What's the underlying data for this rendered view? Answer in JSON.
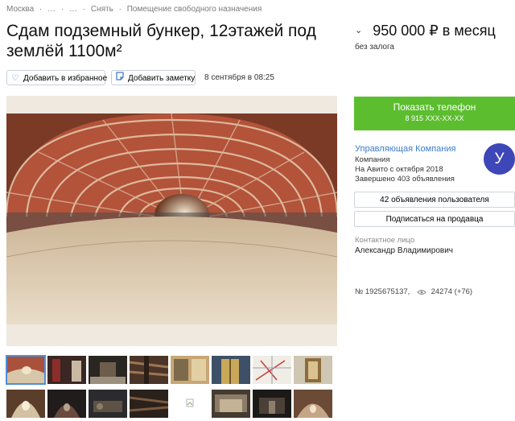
{
  "breadcrumb": {
    "items": [
      "Москва",
      "·",
      "…",
      "·",
      "…",
      "·",
      "Снять",
      "·",
      "Помещение свободного назначения"
    ]
  },
  "listing": {
    "title": "Сдам подземный бункер, 12этажей под землёй 1100м²",
    "price": "950 000 ₽ в месяц",
    "deposit": "без залога",
    "date": "8 сентября в 08:25"
  },
  "actions": {
    "favorite_label": "Добавить в избранное",
    "note_label": "Добавить заметку"
  },
  "call": {
    "label": "Показать телефон",
    "number": "8 915 XXX-XX-XX",
    "color": "#5cbd2f"
  },
  "seller": {
    "name": "Управляющая Компания",
    "type": "Компания",
    "since": "На Авито с октября 2018",
    "completed": "Завершено 403 объявления",
    "avatar_letter": "У",
    "avatar_color": "#3d47b8",
    "ads_button": "42 объявления пользователя",
    "subscribe_button": "Подписаться на продавца"
  },
  "contact": {
    "label": "Контактное лицо",
    "name": "Александр Владимирович"
  },
  "stats": {
    "id": "№ 1925675137,",
    "views": "24274 (+76)"
  },
  "gallery": {
    "thumbs_row1": [
      "tunnel",
      "red-corridor",
      "dark-room",
      "pipes",
      "rack-room",
      "elevator-door",
      "corridor-lit",
      "map",
      "fire-door"
    ],
    "thumbs_row2": [
      "tunnel-arch",
      "dark-tunnel",
      "machinery",
      "pipes-dark",
      "missing-image",
      "hall",
      "dark-hall",
      "tunnel-end"
    ]
  }
}
